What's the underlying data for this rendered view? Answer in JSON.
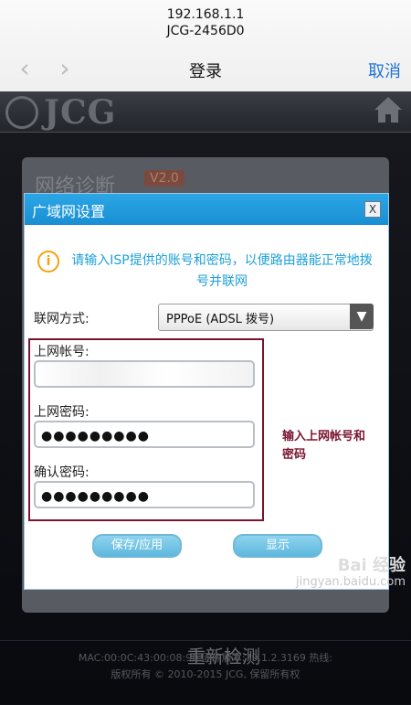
{
  "browser": {
    "host": "192.168.1.1",
    "network": "JCG-2456D0",
    "title": "登录",
    "cancel_label": "取消",
    "back_icon": "‹",
    "forward_icon": "›"
  },
  "background_page": {
    "logo_text": "JCG",
    "card_title": "网络诊断",
    "card_badge": "V2.0",
    "card_button": "重新检测",
    "footer_mac": "MAC:00:0C:43:00:08:90  固件版本:79.1.2.3169  热线:",
    "footer_copyright": "版权所有 © 2010-2015 JCG, 保留所有权"
  },
  "dialog": {
    "title": "广域网设置",
    "close_label": "X",
    "info_icon": "i",
    "info_text": "请输入ISP提供的账号和密码，以便路由器能正常地拨号并联网",
    "connection_mode_label": "联网方式:",
    "connection_mode_value": "PPPoE (ADSL 拨号)",
    "account_label": "上网帐号:",
    "account_value": "",
    "password_label": "上网密码:",
    "password_value": "●●●●●●●●●",
    "confirm_label": "确认密码:",
    "confirm_value": "●●●●●●●●●",
    "save_button": "保存/应用",
    "show_button": "显示"
  },
  "annotation": "输入上网帐号和密码",
  "watermark": {
    "brand": "Bai 经验",
    "url": "jingyan.baidu.com"
  },
  "colors": {
    "accent_blue": "#1e73d8",
    "dialog_header": "#1e9ad8",
    "annotation_red": "#7a1430",
    "info_orange": "#f2a30f"
  }
}
